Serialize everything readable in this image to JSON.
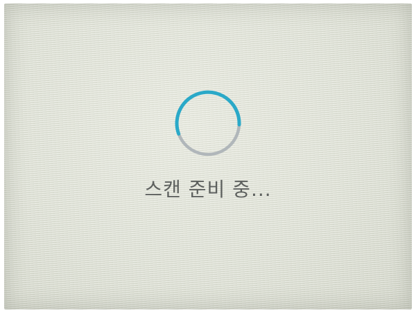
{
  "screen": {
    "status_text": "스캔 준비 중...",
    "spinner_icon": "loading-spinner-icon"
  },
  "colors": {
    "spinner_active": "#2aa9c8",
    "spinner_track": "#a7aeb4",
    "text": "#5d605e"
  }
}
